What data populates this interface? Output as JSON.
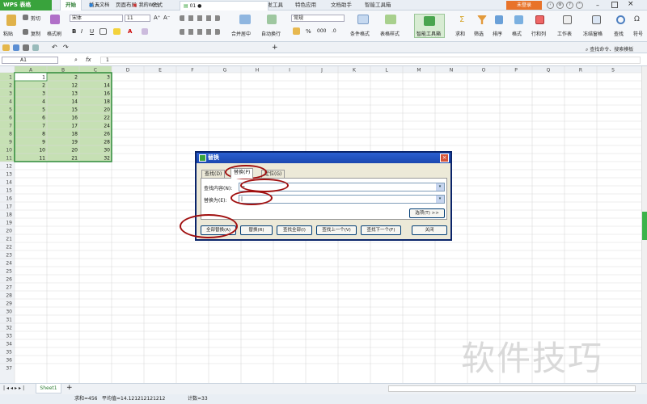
{
  "app": {
    "title": "WPS 表格",
    "brand_color": "#39a33c"
  },
  "menu": {
    "items": [
      "开始",
      "插入",
      "页面布局",
      "公式",
      "数据",
      "审阅",
      "视图",
      "开发工具",
      "特色应用",
      "文档助手",
      "智能工具箱"
    ],
    "active": "开始",
    "login": "未登录"
  },
  "ribbon": {
    "paste": "粘贴",
    "cut": "剪切",
    "copy": "复制",
    "format_painter": "格式刷",
    "font_name": "宋体",
    "font_size": "11",
    "bold": "B",
    "italic": "I",
    "underline": "U",
    "number_format": "常规",
    "merge": "合并居中",
    "wrap": "自动换行",
    "percent": "%",
    "conditional": "条件格式",
    "table_style": "表格样式",
    "smart_toolbox": "智能工具箱",
    "sum": "求和",
    "filter": "筛选",
    "sort": "排序",
    "format": "格式",
    "rowcol": "行和列",
    "worksheet": "工作表",
    "freeze": "冻结窗格",
    "find": "查找",
    "symbol": "符号"
  },
  "tabs": {
    "cloud": "云文档",
    "mywps": "我的WPS",
    "doc": "01",
    "search_hint": "查找命令、搜索模板"
  },
  "formula": {
    "cell_ref": "A1",
    "fx": "fx",
    "value": "1"
  },
  "grid": {
    "columns": [
      "A",
      "B",
      "C",
      "D",
      "E",
      "F",
      "G",
      "H",
      "I",
      "J",
      "K",
      "L",
      "M",
      "N",
      "O",
      "P",
      "Q",
      "R",
      "S"
    ],
    "row_count": 37,
    "data": [
      [
        1,
        2,
        3
      ],
      [
        2,
        12,
        14
      ],
      [
        3,
        13,
        16
      ],
      [
        4,
        14,
        18
      ],
      [
        5,
        15,
        20
      ],
      [
        6,
        16,
        22
      ],
      [
        7,
        17,
        24
      ],
      [
        8,
        18,
        26
      ],
      [
        9,
        19,
        28
      ],
      [
        10,
        20,
        30
      ],
      [
        11,
        21,
        32
      ]
    ],
    "selection_color": "#c6e0b4"
  },
  "dialog": {
    "title": "替换",
    "tabs": [
      "查找(D)",
      "替换(P)",
      "定位(G)"
    ],
    "active_tab": "替换(P)",
    "find_label": "查找内容(N):",
    "find_value": "=",
    "replace_label": "替换为(E):",
    "replace_value": "|",
    "options": "选项(T) >>",
    "buttons": [
      "全部替换(A)",
      "替换(R)",
      "查找全部(I)",
      "查找上一个(V)",
      "查找下一个(F)",
      "关闭"
    ]
  },
  "sheet": {
    "name": "Sheet1",
    "add": "+"
  },
  "status": {
    "sum": "求和=456",
    "avg": "平均值=14.121212121212",
    "count": "计数=33"
  },
  "watermark": "软件技巧"
}
